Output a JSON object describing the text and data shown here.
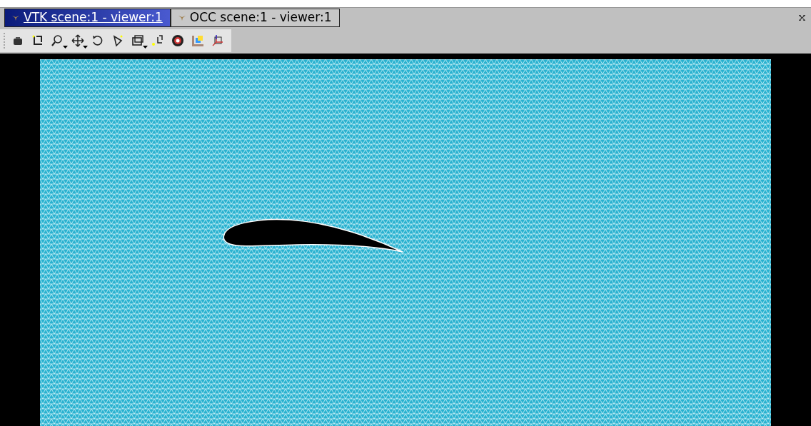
{
  "tabs": [
    {
      "label": "VTK scene:1 - viewer:1",
      "selected": true
    },
    {
      "label": "OCC scene:1 - viewer:1",
      "selected": false
    }
  ]
}
